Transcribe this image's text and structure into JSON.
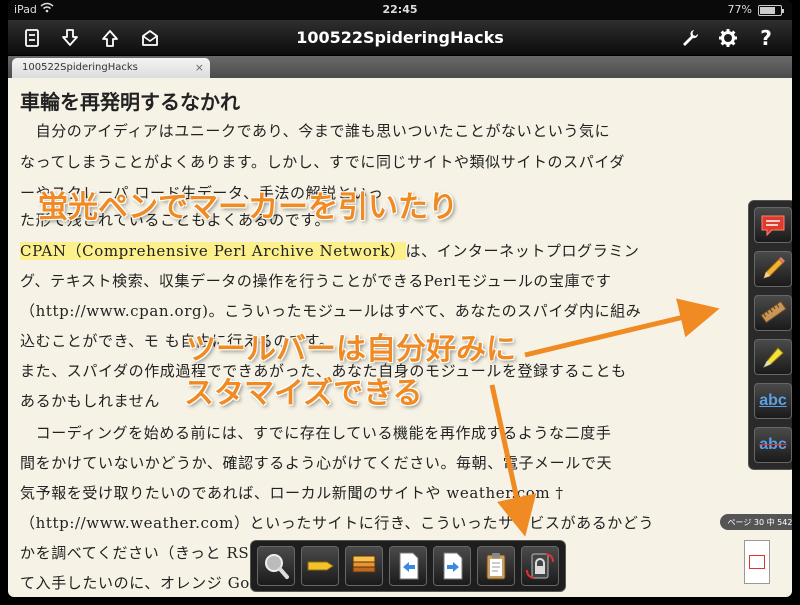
{
  "status": {
    "device": "iPad",
    "time": "22:45",
    "battery": "77%",
    "battery_level": 0.77
  },
  "nav": {
    "title": "100522SpideringHacks"
  },
  "tab": {
    "label": "100522SpideringHacks",
    "close": "×"
  },
  "page": {
    "heading": "車輪を再発明するなかれ",
    "lines": [
      "　自分のアイディアはユニークであり、今まで誰も思いついたことがないという気に",
      "なってしまうことがよくあります。しかし、すでに同じサイトや類似サイトのスパイダ",
      "ーやスクレーパ                   ロード生データ、手法の解説といっ",
      "た形で残されていることもよくあるのです。",
      "CPAN（Comprehensive Perl Archive Network）",
      "は、インターネットプログラミン",
      "グ、テキスト検索、収集データの操作を行うことができるPerlモジュールの宝庫です",
      "（http://www.cpan.org)。こういったモジュールはすべて、あなたのスパイダ内に組み",
      "込むことができ、モ                                   も自由に行えるのです。",
      "また、スパイダの作成過程でできあがった、あなた自身のモジュールを登録することも",
      "あるかもしれません",
      "　コーディングを始める前には、すでに存在している機能を再作成するような二度手",
      "間をかけていないかどうか、確認するよう心がけてください。毎朝、電子メールで天",
      "気予報を受け取りたいのであれば、ローカル新聞のサイトや weather.com †",
      "（http://www.weather.com）といったサイトに行き、こういったサービスがあるかどう",
      "かを調べてください（きっと                                RSSフィードとし",
      "て入手したいのに、オレンジ                                Googleで検索し"
    ]
  },
  "captions": {
    "marker": "蛍光ペンでマーカーを引いたり",
    "toolbar1": "ツールバーは自分好みに",
    "toolbar2": "スタマイズできる"
  },
  "page_indicator": {
    "text": "ページ 30 中 542"
  },
  "colors": {
    "caption": "#f08a22",
    "highlight": "#fbf08c",
    "accent": "#e03030"
  },
  "icons": {
    "nav_left": [
      "bookmark-list-icon",
      "download-icon",
      "upload-icon",
      "mail-icon"
    ],
    "nav_right": [
      "wrench-icon",
      "gear-icon",
      "help-icon"
    ],
    "right_toolbar": [
      "note-icon",
      "pencil-icon",
      "ruler-icon",
      "highlighter-icon",
      "underline-icon",
      "strikethrough-icon"
    ],
    "bottom_toolbar": [
      "magnifier-icon",
      "highlight-marker-icon",
      "layers-icon",
      "prev-page-icon",
      "next-page-icon",
      "clipboard-icon",
      "rotation-lock-icon"
    ]
  },
  "text_tools": {
    "underline": "abc",
    "strike": "abc"
  },
  "help_glyph": "?"
}
